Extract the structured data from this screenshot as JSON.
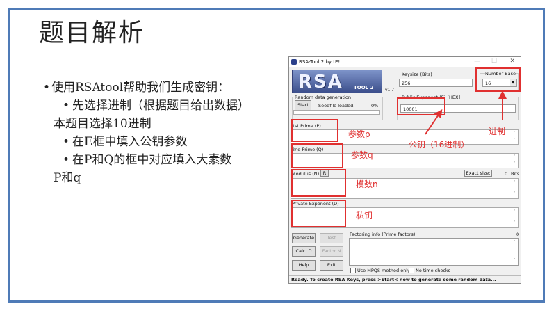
{
  "slide": {
    "title": "题目解析",
    "bullet_main": "使用RSAtool帮助我们生成密钥：",
    "sub_bullets": [
      "先选择进制（根据题目给出数据）",
      "在E框中填入公钥参数",
      "在P和Q的框中对应填入大素数"
    ],
    "sub1_cont": "本题目选择10进制",
    "sub3_cont": "P和q"
  },
  "window": {
    "title": "RSA-Tool 2 by tE!",
    "logo_text": "RSA",
    "logo_sub": "TOOL 2",
    "version": "v1.7",
    "keysize_label": "Keysize (Bits)",
    "keysize_value": "256",
    "number_base_label": "Number Base",
    "number_base_value": "16",
    "random_label": "Random data generation",
    "start_label": "Start",
    "seedfile_text": "Seedfile loaded.",
    "percent": "0%",
    "pubexp_label": "Public Exponent (E) [HEX]",
    "pubexp_value": "10001",
    "p_label": "1st Prime (P)",
    "q_label": "2nd Prime (Q)",
    "n_label": "Modulus (N)",
    "r_label": "R",
    "exact_size_label": "Exact size:",
    "exact_size_value": "0",
    "bits": "Bits",
    "d_label": "Private Exponent (D)",
    "generate": "Generate",
    "test": "Test",
    "calc_d": "Calc. D",
    "factor_n": "Factor N",
    "help": "Help",
    "exit": "Exit",
    "factoring_label": "Factoring info (Prime factors):",
    "factoring_count": "0",
    "mpqs": "Use MPQS method only",
    "no_time": "No time checks",
    "dashes": "- - -",
    "status": "Ready. To create RSA Keys, press >Start< now to generate some random data..."
  },
  "annotations": {
    "p": "参数p",
    "q": "参数q",
    "n": "模数n",
    "d": "私钥",
    "e": "公钥（16进制）",
    "base": "进制"
  },
  "colors": {
    "accent_red": "#e03030",
    "frame_blue": "#4f7bb7"
  }
}
